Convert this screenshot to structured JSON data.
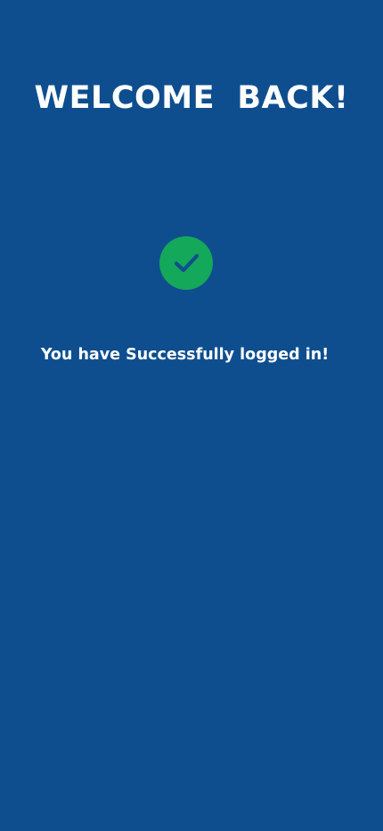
{
  "colors": {
    "background": "#0e4e8f",
    "success": "#14a85a",
    "checkmark": "#0e4e8f",
    "text": "#ffffff"
  },
  "screen": {
    "title": "WELCOME  BACK!",
    "icon": "check-circle-icon",
    "message": "You have Successfully logged in!"
  }
}
